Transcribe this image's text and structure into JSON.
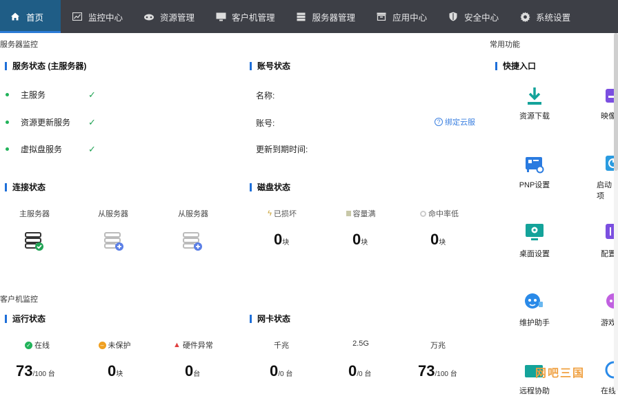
{
  "nav": {
    "items": [
      {
        "label": "首页",
        "icon": "home-icon"
      },
      {
        "label": "监控中心",
        "icon": "monitor-chart-icon"
      },
      {
        "label": "资源管理",
        "icon": "resource-icon"
      },
      {
        "label": "客户机管理",
        "icon": "desktop-icon"
      },
      {
        "label": "服务器管理",
        "icon": "server-icon"
      },
      {
        "label": "应用中心",
        "icon": "app-box-icon"
      },
      {
        "label": "安全中心",
        "icon": "shield-icon"
      },
      {
        "label": "系统设置",
        "icon": "gear-icon"
      }
    ]
  },
  "server_monitor": {
    "section": "服务器监控",
    "service_status": {
      "title": "服务状态 (主服务器)",
      "items": [
        {
          "name": "主服务"
        },
        {
          "name": "资源更新服务"
        },
        {
          "name": "虚拟盘服务"
        }
      ]
    },
    "account_status": {
      "title": "账号状态",
      "name_label": "名称:",
      "account_label": "账号:",
      "expiry_label": "更新到期时间:",
      "bind_link": "绑定云服"
    },
    "connection_status": {
      "title": "连接状态",
      "servers": [
        "主服务器",
        "从服务器",
        "从服务器"
      ]
    },
    "disk_status": {
      "title": "磁盘状态",
      "items": [
        {
          "label": "已损坏",
          "value": "0",
          "unit": "块"
        },
        {
          "label": "容量满",
          "value": "0",
          "unit": "块"
        },
        {
          "label": "命中率低",
          "value": "0",
          "unit": "块"
        }
      ]
    }
  },
  "client_monitor": {
    "section": "客户机监控",
    "run_status": {
      "title": "运行状态",
      "items": [
        {
          "label": "在线",
          "value": "73",
          "unit": "/100 台"
        },
        {
          "label": "未保护",
          "value": "0",
          "unit": "块"
        },
        {
          "label": "硬件异常",
          "value": "0",
          "unit": "台"
        }
      ]
    },
    "nic_status": {
      "title": "网卡状态",
      "items": [
        {
          "label": "千兆",
          "value": "0",
          "unit": "/0 台"
        },
        {
          "label": "2.5G",
          "value": "0",
          "unit": "/0 台"
        },
        {
          "label": "万兆",
          "value": "73",
          "unit": "/100 台"
        }
      ]
    }
  },
  "common_functions": {
    "section": "常用功能",
    "title": "快捷入口",
    "items": [
      {
        "label": "资源下载",
        "icon": "download-icon"
      },
      {
        "label": "映像",
        "icon": "image-icon"
      },
      {
        "label": "PNP设置",
        "icon": "pnp-card-icon"
      },
      {
        "label": "启动项",
        "icon": "power-icon"
      },
      {
        "label": "桌面设置",
        "icon": "desktop-settings-icon"
      },
      {
        "label": "配置",
        "icon": "config-icon"
      },
      {
        "label": "维护助手",
        "icon": "assistant-icon"
      },
      {
        "label": "游戏",
        "icon": "game-icon"
      },
      {
        "label": "远程协助",
        "icon": "remote-icon"
      },
      {
        "label": "在线",
        "icon": "online-icon"
      }
    ]
  },
  "watermark": "网吧三国",
  "colors": {
    "nav_bg": "#3d3f46",
    "active_bg": "#1f5d86",
    "accent": "#1e6fd9",
    "ok": "#21a354"
  }
}
